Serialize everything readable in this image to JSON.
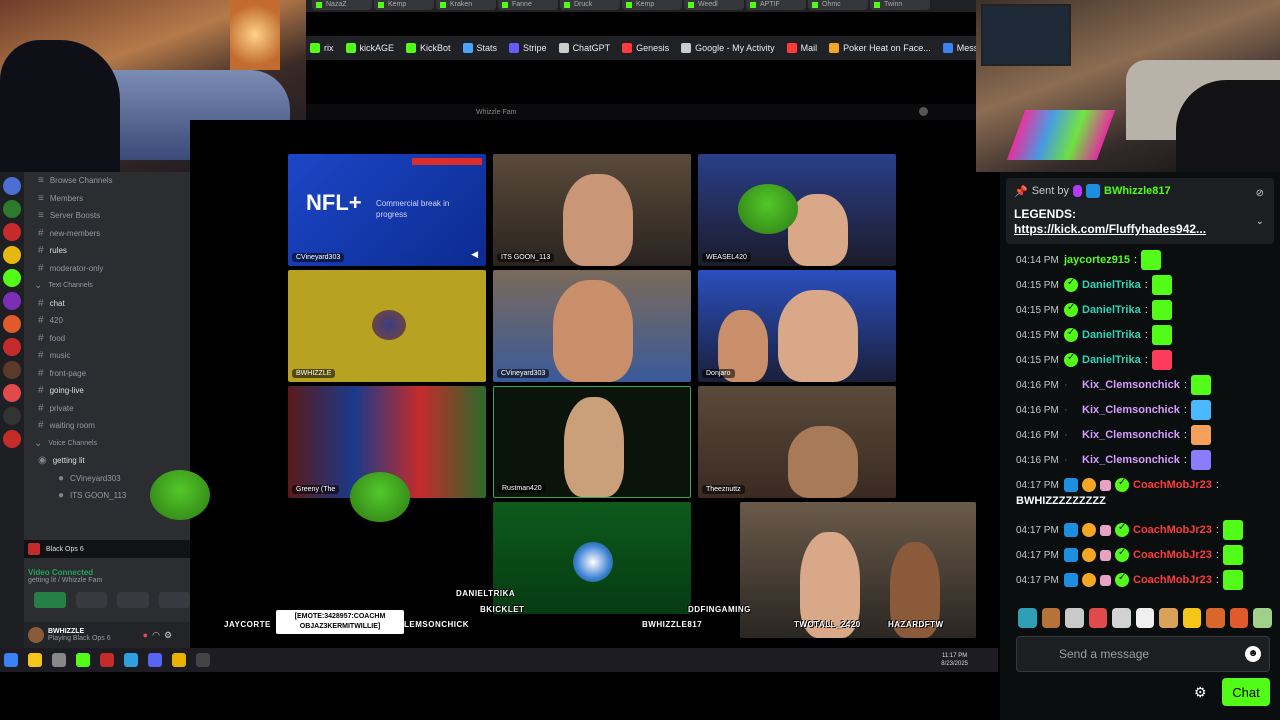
{
  "browser": {
    "tabs": [
      "NazaZ",
      "Kemp",
      "Kraken",
      "Fanne",
      "Druck",
      "Kemp",
      "Weedl",
      "APTIF",
      "Ohmc",
      "Twinn"
    ],
    "bookmarks": [
      {
        "label": "rix",
        "color": "#53fc18"
      },
      {
        "label": "kickAGE",
        "color": "#53fc18"
      },
      {
        "label": "KickBot",
        "color": "#53fc18"
      },
      {
        "label": "Stats",
        "color": "#4aa3ff"
      },
      {
        "label": "Stripe",
        "color": "#635bff"
      },
      {
        "label": "ChatGPT",
        "color": "#cccccc"
      },
      {
        "label": "Genesis",
        "color": "#ff3b3b"
      },
      {
        "label": "Google - My Activity",
        "color": "#cccccc"
      },
      {
        "label": "Mail",
        "color": "#ff3b3b"
      },
      {
        "label": "Poker Heat on Face...",
        "color": "#f5a623"
      },
      {
        "label": "Messeng",
        "color": "#3b82f6"
      }
    ],
    "window_title": "Whizzle Fam"
  },
  "discord": {
    "channels": [
      {
        "label": "Browse Channels",
        "type": "nav"
      },
      {
        "label": "Members",
        "type": "nav"
      },
      {
        "label": "Server Boosts",
        "type": "nav"
      },
      {
        "label": "new-members",
        "type": "text"
      },
      {
        "label": "rules",
        "type": "text",
        "bright": true
      },
      {
        "label": "moderator-only",
        "type": "text"
      },
      {
        "label": "Text Channels",
        "type": "cat"
      },
      {
        "label": "chat",
        "type": "text",
        "bright": true
      },
      {
        "label": "420",
        "type": "text"
      },
      {
        "label": "food",
        "type": "text"
      },
      {
        "label": "music",
        "type": "text"
      },
      {
        "label": "front-page",
        "type": "text"
      },
      {
        "label": "going-live",
        "type": "text",
        "bright": true
      },
      {
        "label": "private",
        "type": "text"
      },
      {
        "label": "waiting room",
        "type": "text"
      },
      {
        "label": "Voice Channels",
        "type": "cat"
      },
      {
        "label": "getting lit",
        "type": "voice",
        "bright": true
      },
      {
        "label": "CVineyard303",
        "type": "member"
      },
      {
        "label": "ITS GOON_113",
        "type": "member"
      }
    ],
    "game_activity": "Black Ops 6",
    "voice_connected": "Video Connected",
    "voice_channel": "getting lit / Whizzle Fam",
    "user": {
      "name": "BWHIZZLE",
      "status": "Playing Black Ops 6"
    }
  },
  "video_tiles": [
    {
      "label": "CVineyard303",
      "nfl_logo": "NFL+",
      "nfl_text": "Commercial break in progress"
    },
    {
      "label": "ITS GOON_113"
    },
    {
      "label": "WEASEL420"
    },
    {
      "label": "BWHIZZLE"
    },
    {
      "label": "CVineyard303"
    },
    {
      "label": "Donjaro"
    },
    {
      "label": "Greeny (The"
    },
    {
      "label": "Rustman420"
    },
    {
      "label": "Theeznuttz"
    }
  ],
  "overlay": {
    "names": [
      "JAYCORTE",
      "LEMSONCHICK",
      "DANIELTRIKA",
      "BKICKLET",
      "BWHIZZLE817",
      "DDFINGAMING",
      "TWOTALL_2420",
      "HAZARDFTW"
    ],
    "emote_bubble": "[EMOTE:3428957:COACHM OBJAZ3KERMITWILLIE]"
  },
  "taskbar": {
    "time": "11:17 PM",
    "date": "8/23/2025"
  },
  "chat": {
    "pinned": {
      "sent_by_label": "Sent by",
      "sender": "BWhizzle817",
      "text": "LEGENDS:",
      "link": "https://kick.com/Fluffyhades942..."
    },
    "messages": [
      {
        "time": "04:14 PM",
        "user": "jaycortez915",
        "color": "#53fc18",
        "badges": [],
        "emote": "#53fc18"
      },
      {
        "time": "04:15 PM",
        "user": "DanielTrika",
        "color": "#2fd3b5",
        "badges": [
          "verified"
        ],
        "emote": "#53fc18"
      },
      {
        "time": "04:15 PM",
        "user": "DanielTrika",
        "color": "#2fd3b5",
        "badges": [
          "verified"
        ],
        "emote": "#53fc18"
      },
      {
        "time": "04:15 PM",
        "user": "DanielTrika",
        "color": "#2fd3b5",
        "badges": [
          "verified"
        ],
        "emote": "#53fc18"
      },
      {
        "time": "04:15 PM",
        "user": "DanielTrika",
        "color": "#2fd3b5",
        "badges": [
          "verified"
        ],
        "emote": "#ff3b5c"
      },
      {
        "time": "04:16 PM",
        "user": "Kix_Clemsonchick",
        "color": "#d69cff",
        "badges": [
          "dot"
        ],
        "emote": "#53fc18"
      },
      {
        "time": "04:16 PM",
        "user": "Kix_Clemsonchick",
        "color": "#d69cff",
        "badges": [
          "dot"
        ],
        "emote": "#4ab8ff"
      },
      {
        "time": "04:16 PM",
        "user": "Kix_Clemsonchick",
        "color": "#d69cff",
        "badges": [
          "dot"
        ],
        "emote": "#f5a05a"
      },
      {
        "time": "04:16 PM",
        "user": "Kix_Clemsonchick",
        "color": "#d69cff",
        "badges": [
          "dot"
        ],
        "emote": "#8a7bff"
      },
      {
        "time": "04:17 PM",
        "user": "CoachMobJr23",
        "color": "#ff3b3b",
        "badges": [
          "sub",
          "gift",
          "pink",
          "verified"
        ],
        "text": "BWHIZZZZZZZZZ"
      },
      {
        "time": "04:17 PM",
        "user": "CoachMobJr23",
        "color": "#ff3b3b",
        "badges": [
          "sub",
          "gift",
          "pink",
          "verified"
        ],
        "emote": "#53fc18"
      },
      {
        "time": "04:17 PM",
        "user": "CoachMobJr23",
        "color": "#ff3b3b",
        "badges": [
          "sub",
          "gift",
          "pink",
          "verified"
        ],
        "emote": "#53fc18"
      },
      {
        "time": "04:17 PM",
        "user": "CoachMobJr23",
        "color": "#ff3b3b",
        "badges": [
          "sub",
          "gift",
          "pink",
          "verified"
        ],
        "emote": "#53fc18"
      }
    ],
    "emote_tray": [
      "#2e9fb5",
      "#b5733a",
      "#c9c9c9",
      "#e04a4a",
      "#d2d2d2",
      "#f0f0f0",
      "#d9a15a",
      "#f5c518",
      "#d9662b",
      "#e05a2b",
      "#9fd18a"
    ],
    "input_placeholder": "Send a message",
    "send_label": "Chat"
  }
}
